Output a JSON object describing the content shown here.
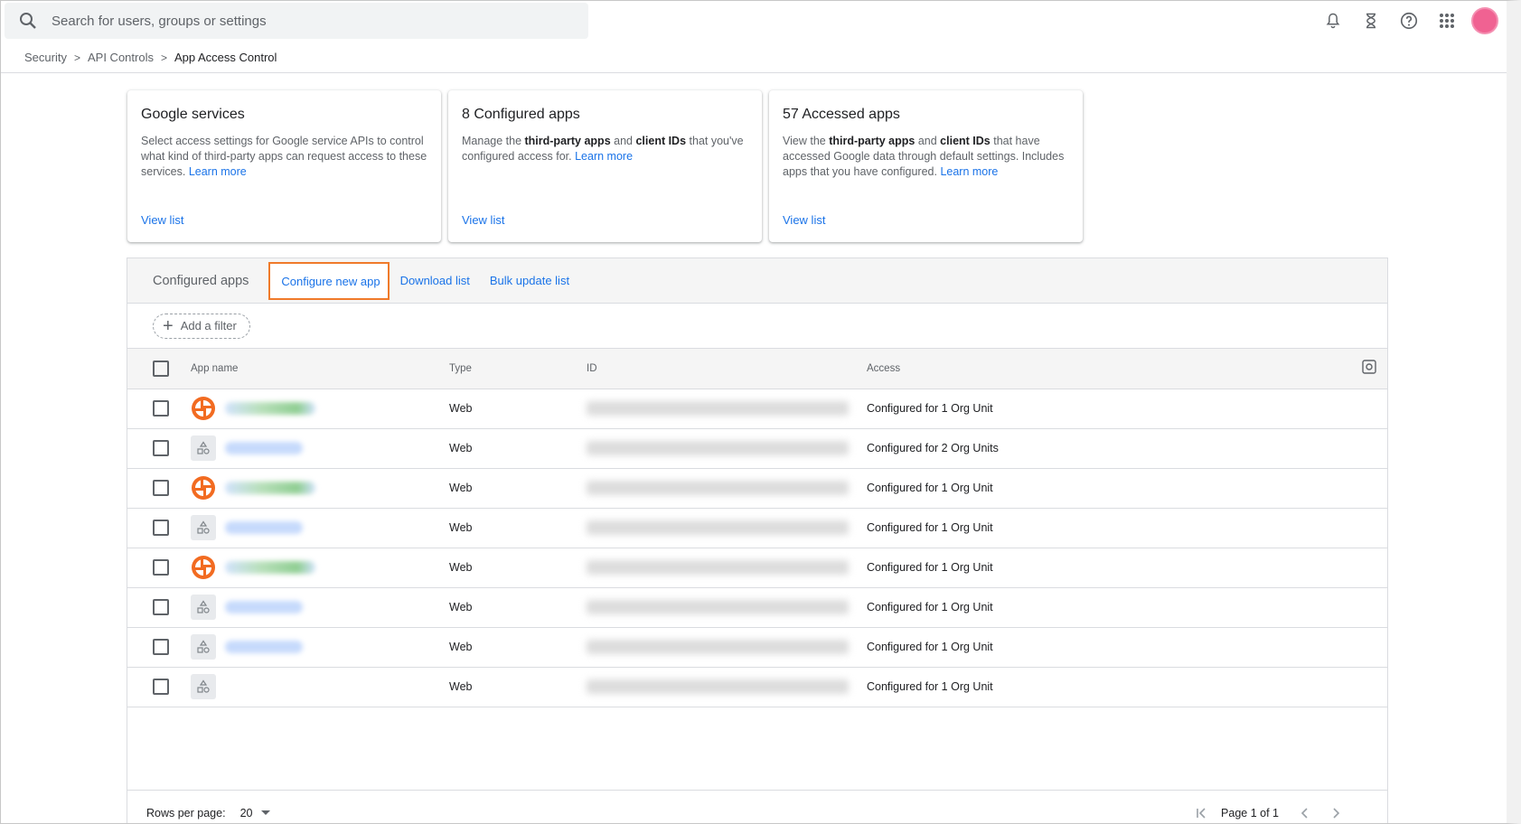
{
  "search": {
    "placeholder": "Search for users, groups or settings"
  },
  "breadcrumb": {
    "items": [
      "Security",
      "API Controls"
    ],
    "current": "App Access Control"
  },
  "cards": [
    {
      "title": "Google services",
      "text_before": "Select access settings for Google service APIs to control what kind of third-party apps can request access to these services.",
      "learn_more": "Learn more",
      "view_list": "View list"
    },
    {
      "title": "8 Configured apps",
      "text_a": "Manage the ",
      "bold_a": "third-party apps",
      "text_b": " and ",
      "bold_b": "client IDs",
      "text_c": " that you've configured access for.",
      "learn_more": "Learn more",
      "view_list": "View list"
    },
    {
      "title": "57 Accessed apps",
      "text_a": "View the ",
      "bold_a": "third-party apps",
      "text_b": " and ",
      "bold_b": "client IDs",
      "text_c": " that have accessed Google data through default settings. Includes apps that you have configured.",
      "learn_more": "Learn more",
      "view_list": "View list"
    }
  ],
  "panel": {
    "title": "Configured apps",
    "actions": {
      "configure": "Configure new app",
      "download": "Download list",
      "bulk": "Bulk update list"
    },
    "add_filter": "Add a filter"
  },
  "table": {
    "columns": {
      "name": "App name",
      "type": "Type",
      "id": "ID",
      "access": "Access"
    },
    "rows": [
      {
        "icon": "orange-swirl-icon",
        "type": "Web",
        "access": "Configured for 1 Org Unit"
      },
      {
        "icon": "generic-app-icon",
        "type": "Web",
        "access": "Configured for 2 Org Units"
      },
      {
        "icon": "orange-swirl-icon",
        "type": "Web",
        "access": "Configured for 1 Org Unit"
      },
      {
        "icon": "generic-app-icon",
        "type": "Web",
        "access": "Configured for 1 Org Unit"
      },
      {
        "icon": "orange-swirl-icon",
        "type": "Web",
        "access": "Configured for 1 Org Unit"
      },
      {
        "icon": "generic-app-icon",
        "type": "Web",
        "access": "Configured for 1 Org Unit"
      },
      {
        "icon": "generic-app-icon",
        "type": "Web",
        "access": "Configured for 1 Org Unit"
      },
      {
        "icon": "generic-app-icon",
        "type": "Web",
        "access": "Configured for 1 Org Unit"
      }
    ]
  },
  "footer": {
    "rows_per_page_label": "Rows per page:",
    "rows_per_page_value": "20",
    "page_label": "Page 1 of 1"
  },
  "colors": {
    "accent": "#1a73e8",
    "highlight": "#f07a2a",
    "avatar": "#f06292"
  }
}
